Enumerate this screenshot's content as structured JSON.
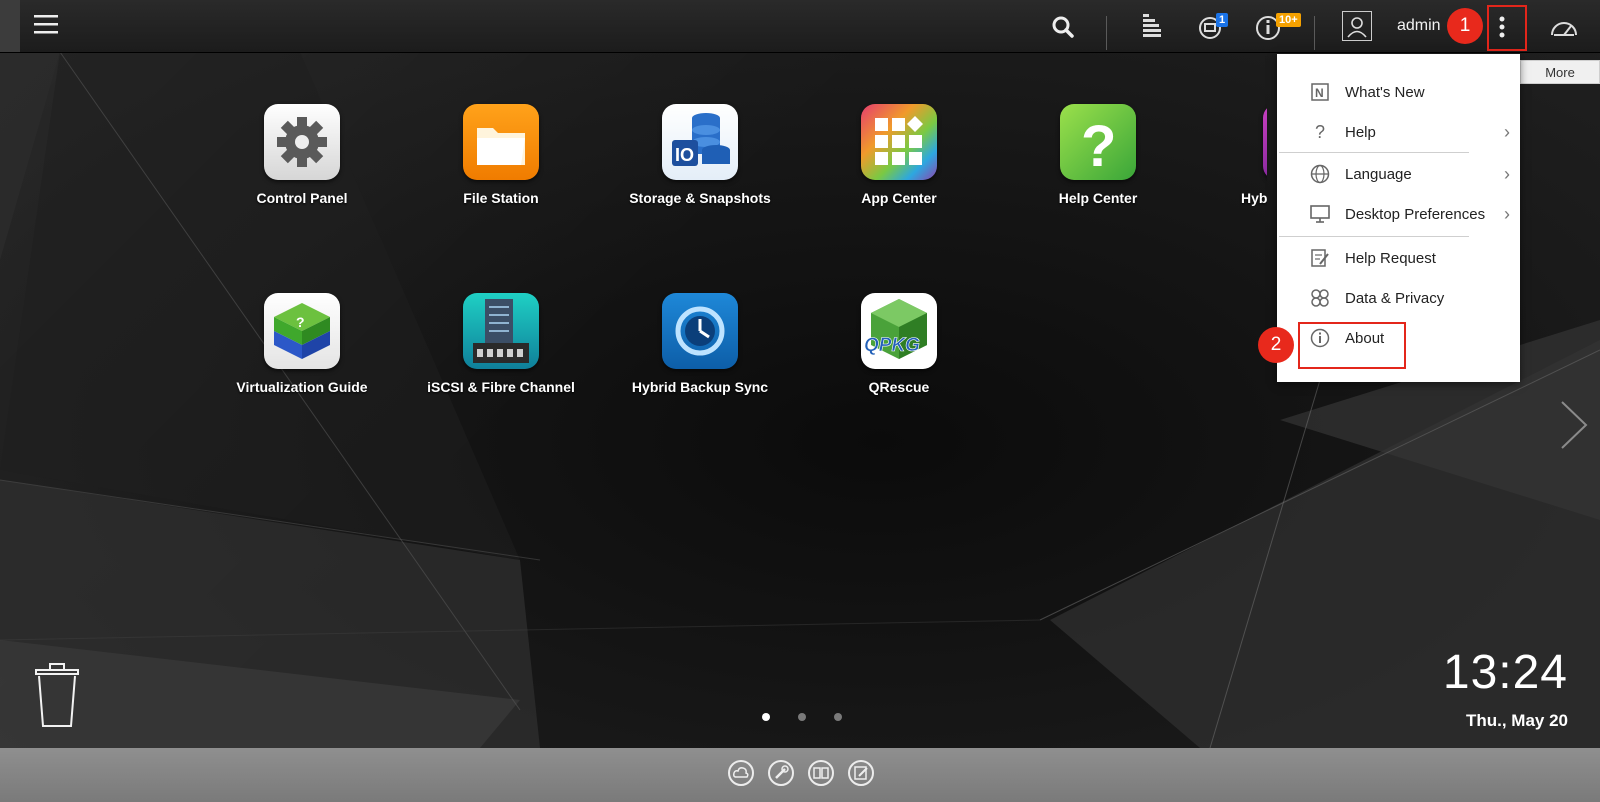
{
  "topbar": {
    "menu_icon": "hamburger-icon",
    "search_icon": "search-icon",
    "tasks_icon": "background-tasks-icon",
    "devices_icon": "external-devices-icon",
    "devices_badge": "1",
    "notifications_icon": "info-icon",
    "notifications_badge": "10+",
    "user_icon": "user-icon",
    "user_name": "admin",
    "more_icon": "more-vertical-icon",
    "dashboard_icon": "dashboard-gauge-icon",
    "more_tooltip": "More"
  },
  "annotations": {
    "marker_1": "1",
    "marker_2": "2",
    "marker_color": "#e8291c"
  },
  "apps": [
    {
      "label": "Control Panel",
      "icon": "gear-icon"
    },
    {
      "label": "File Station",
      "icon": "folder-icon"
    },
    {
      "label": "Storage & Snapshots",
      "icon": "storage-icon"
    },
    {
      "label": "App Center",
      "icon": "app-grid-icon"
    },
    {
      "label": "Help Center",
      "icon": "question-icon"
    },
    {
      "label": "Hybrid",
      "icon": "hybrid-app-icon"
    },
    {
      "label": "Virtualization Guide",
      "icon": "virtualization-cube-icon"
    },
    {
      "label": "iSCSI & Fibre Channel",
      "icon": "iscsi-server-icon"
    },
    {
      "label": "Hybrid Backup Sync",
      "icon": "backup-clock-icon"
    },
    {
      "label": "QRescue",
      "icon": "qpkg-box-icon"
    }
  ],
  "qpkg_text": "QPKG",
  "menu": {
    "items": [
      {
        "label": "What's New",
        "icon": "whats-new-icon",
        "submenu": false
      },
      {
        "label": "Help",
        "icon": "question-mark-icon",
        "submenu": true
      },
      {
        "label": "Language",
        "icon": "globe-icon",
        "submenu": true
      },
      {
        "label": "Desktop Preferences",
        "icon": "monitor-icon",
        "submenu": true
      },
      {
        "label": "Help Request",
        "icon": "edit-note-icon",
        "submenu": false
      },
      {
        "label": "Data & Privacy",
        "icon": "privacy-icon",
        "submenu": false
      },
      {
        "label": "About",
        "icon": "info-circle-icon",
        "submenu": false
      }
    ]
  },
  "pagination": {
    "pages": 3,
    "current": 1
  },
  "clock": {
    "time": "13:24",
    "date": "Thu., May 20"
  },
  "dock": [
    "cloud-link-icon",
    "tools-icon",
    "manual-book-icon",
    "feedback-icon"
  ],
  "colors": {
    "accent_red": "#e3261b",
    "badge_blue": "#1a73e8",
    "badge_orange": "#f5a100"
  }
}
